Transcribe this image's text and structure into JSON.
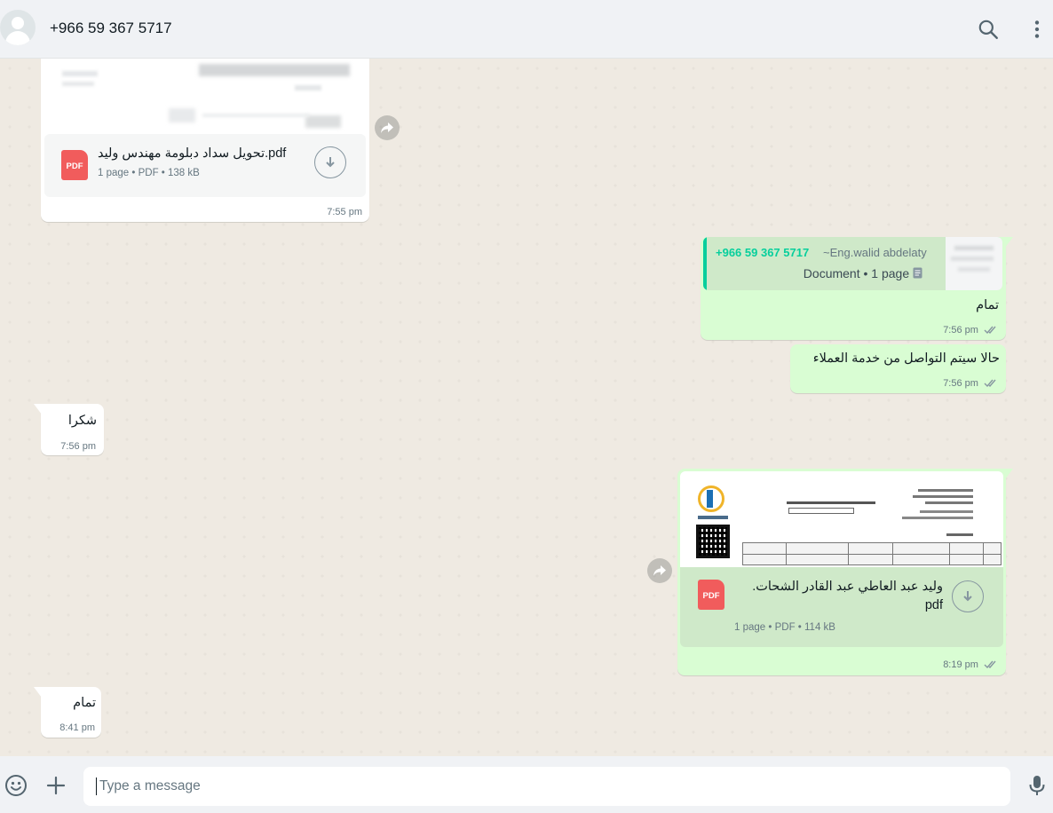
{
  "header": {
    "contact_name": "+966 59 367 5717",
    "icons": [
      "avatar-icon",
      "search-icon",
      "menu-icon"
    ]
  },
  "messages": {
    "m1": {
      "direction": "incoming",
      "doc_title": "تحويل سداد دبلومة مهندس وليد.pdf",
      "doc_meta": "1 page • PDF • 138 kB",
      "time": "7:55 pm"
    },
    "m2": {
      "direction": "outgoing",
      "quote_sender": "+966 59 367 5717",
      "quote_author": "~Eng.walid abdelaty",
      "quote_caption": "Document • 1 page",
      "text": "تمام",
      "time": "7:56 pm"
    },
    "m3": {
      "direction": "outgoing",
      "text": "حالا سيتم التواصل من خدمة العملاء",
      "time": "7:56 pm"
    },
    "m4": {
      "direction": "incoming",
      "text": "شكرا",
      "time": "7:56 pm"
    },
    "m5": {
      "direction": "outgoing",
      "doc_title_line1": "وليد عبد العاطي عبد القادر الشحات.",
      "doc_title_line2": "pdf",
      "doc_meta": "1 page • PDF • 114 kB",
      "time": "8:19 pm"
    },
    "m6": {
      "direction": "incoming",
      "text": "تمام",
      "time": "8:41 pm"
    }
  },
  "pdf_badge": "PDF",
  "composer": {
    "placeholder": "Type a message",
    "icons": [
      "emoji-icon",
      "attach-plus-icon",
      "microphone-icon"
    ]
  },
  "colors": {
    "header_bg": "#f0f2f5",
    "chat_bg": "#efeae2",
    "outgoing_bubble": "#d9fdd3",
    "incoming_bubble": "#ffffff",
    "quote_accent": "#06cf9c",
    "read_ticks": "#53bdeb",
    "pdf_red": "#f15c5c"
  }
}
